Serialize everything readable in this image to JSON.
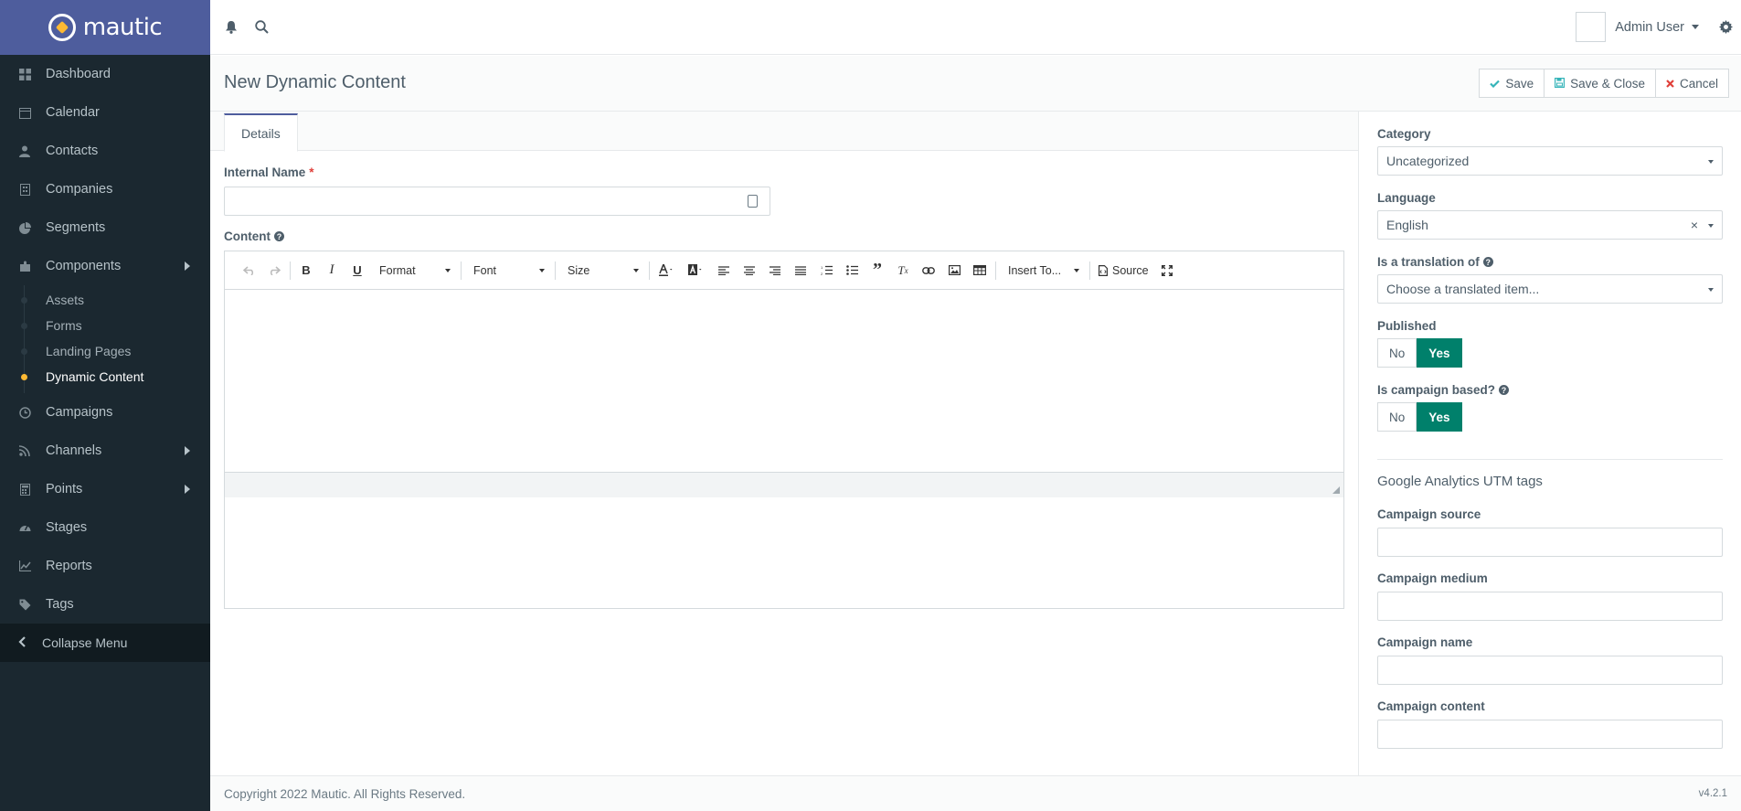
{
  "brand": {
    "name": "mautic"
  },
  "sidebar": {
    "items": [
      {
        "label": "Dashboard",
        "icon": "dashboard-icon"
      },
      {
        "label": "Calendar",
        "icon": "calendar-icon"
      },
      {
        "label": "Contacts",
        "icon": "user-icon"
      },
      {
        "label": "Companies",
        "icon": "building-icon"
      },
      {
        "label": "Segments",
        "icon": "pie-chart-icon"
      },
      {
        "label": "Components",
        "icon": "puzzle-icon"
      }
    ],
    "sub_items": [
      {
        "label": "Assets"
      },
      {
        "label": "Forms"
      },
      {
        "label": "Landing Pages"
      },
      {
        "label": "Dynamic Content",
        "active": true
      }
    ],
    "items2": [
      {
        "label": "Campaigns",
        "icon": "clock-icon"
      },
      {
        "label": "Channels",
        "icon": "rss-icon"
      },
      {
        "label": "Points",
        "icon": "calculator-icon"
      },
      {
        "label": "Stages",
        "icon": "tachometer-icon"
      },
      {
        "label": "Reports",
        "icon": "line-chart-icon"
      },
      {
        "label": "Tags",
        "icon": "tag-icon"
      }
    ],
    "collapse_label": "Collapse Menu"
  },
  "topbar": {
    "user_name": "Admin User"
  },
  "page": {
    "title": "New Dynamic Content",
    "save_label": "Save",
    "save_close_label": "Save & Close",
    "cancel_label": "Cancel"
  },
  "main": {
    "tab_details": "Details",
    "internal_name_label": "Internal Name",
    "required_mark": "*",
    "content_label": "Content"
  },
  "editor": {
    "format_label": "Format",
    "font_label": "Font",
    "size_label": "Size",
    "insert_label": "Insert To...",
    "source_label": "Source"
  },
  "right": {
    "category_label": "Category",
    "category_value": "Uncategorized",
    "language_label": "Language",
    "language_value": "English",
    "translation_label": "Is a translation of",
    "translation_placeholder": "Choose a translated item...",
    "published_label": "Published",
    "campaign_based_label": "Is campaign based?",
    "no_label": "No",
    "yes_label": "Yes",
    "utm_title": "Google Analytics UTM tags",
    "utm_source_label": "Campaign source",
    "utm_medium_label": "Campaign medium",
    "utm_name_label": "Campaign name",
    "utm_content_label": "Campaign content"
  },
  "footer": {
    "copyright": "Copyright 2022 Mautic. All Rights Reserved.",
    "version": "v4.2.1"
  },
  "colors": {
    "sidebar_bg": "#1b2830",
    "brand_bg": "#4e5d9d",
    "accent_yellow": "#fdb933",
    "toggle_on": "#00806b",
    "cancel_red": "#e0403a"
  }
}
